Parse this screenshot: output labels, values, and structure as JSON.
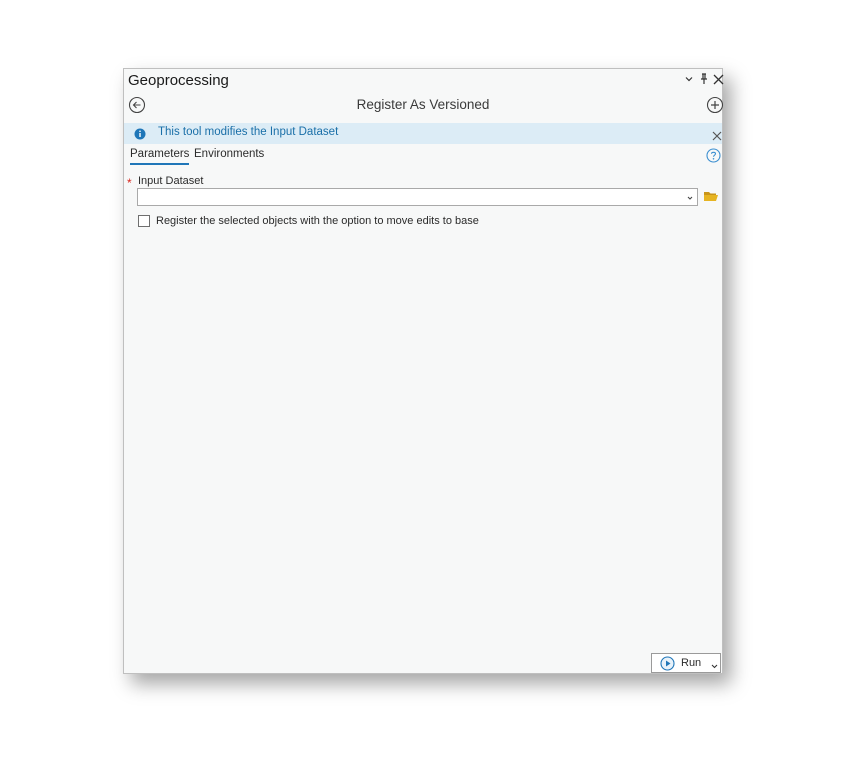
{
  "pane": {
    "title": "Geoprocessing"
  },
  "tool": {
    "title": "Register As Versioned"
  },
  "info": {
    "message": "This tool modifies the Input Dataset"
  },
  "tabs": [
    {
      "label": "Parameters",
      "active": true
    },
    {
      "label": "Environments",
      "active": false
    }
  ],
  "parameters": {
    "input_dataset": {
      "label": "Input Dataset",
      "required_marker": "*",
      "value": ""
    },
    "move_edits_option": {
      "label": "Register the selected objects with the option to move edits to base",
      "checked": false
    }
  },
  "run_button": {
    "label": "Run"
  },
  "colors": {
    "accent": "#1f76b8",
    "info_background": "#dcecf6",
    "info_text": "#1a6fa8",
    "required": "#d7261e",
    "folder": "#e6b422"
  },
  "icons": {
    "pane_menu": "chevron-down-icon",
    "auto_hide": "pin-icon",
    "close": "close-icon",
    "back": "back-arrow-icon",
    "add": "plus-circle-icon",
    "info": "info-icon",
    "dismiss": "close-icon",
    "help": "help-icon",
    "browse": "folder-open-icon",
    "run": "play-icon"
  }
}
